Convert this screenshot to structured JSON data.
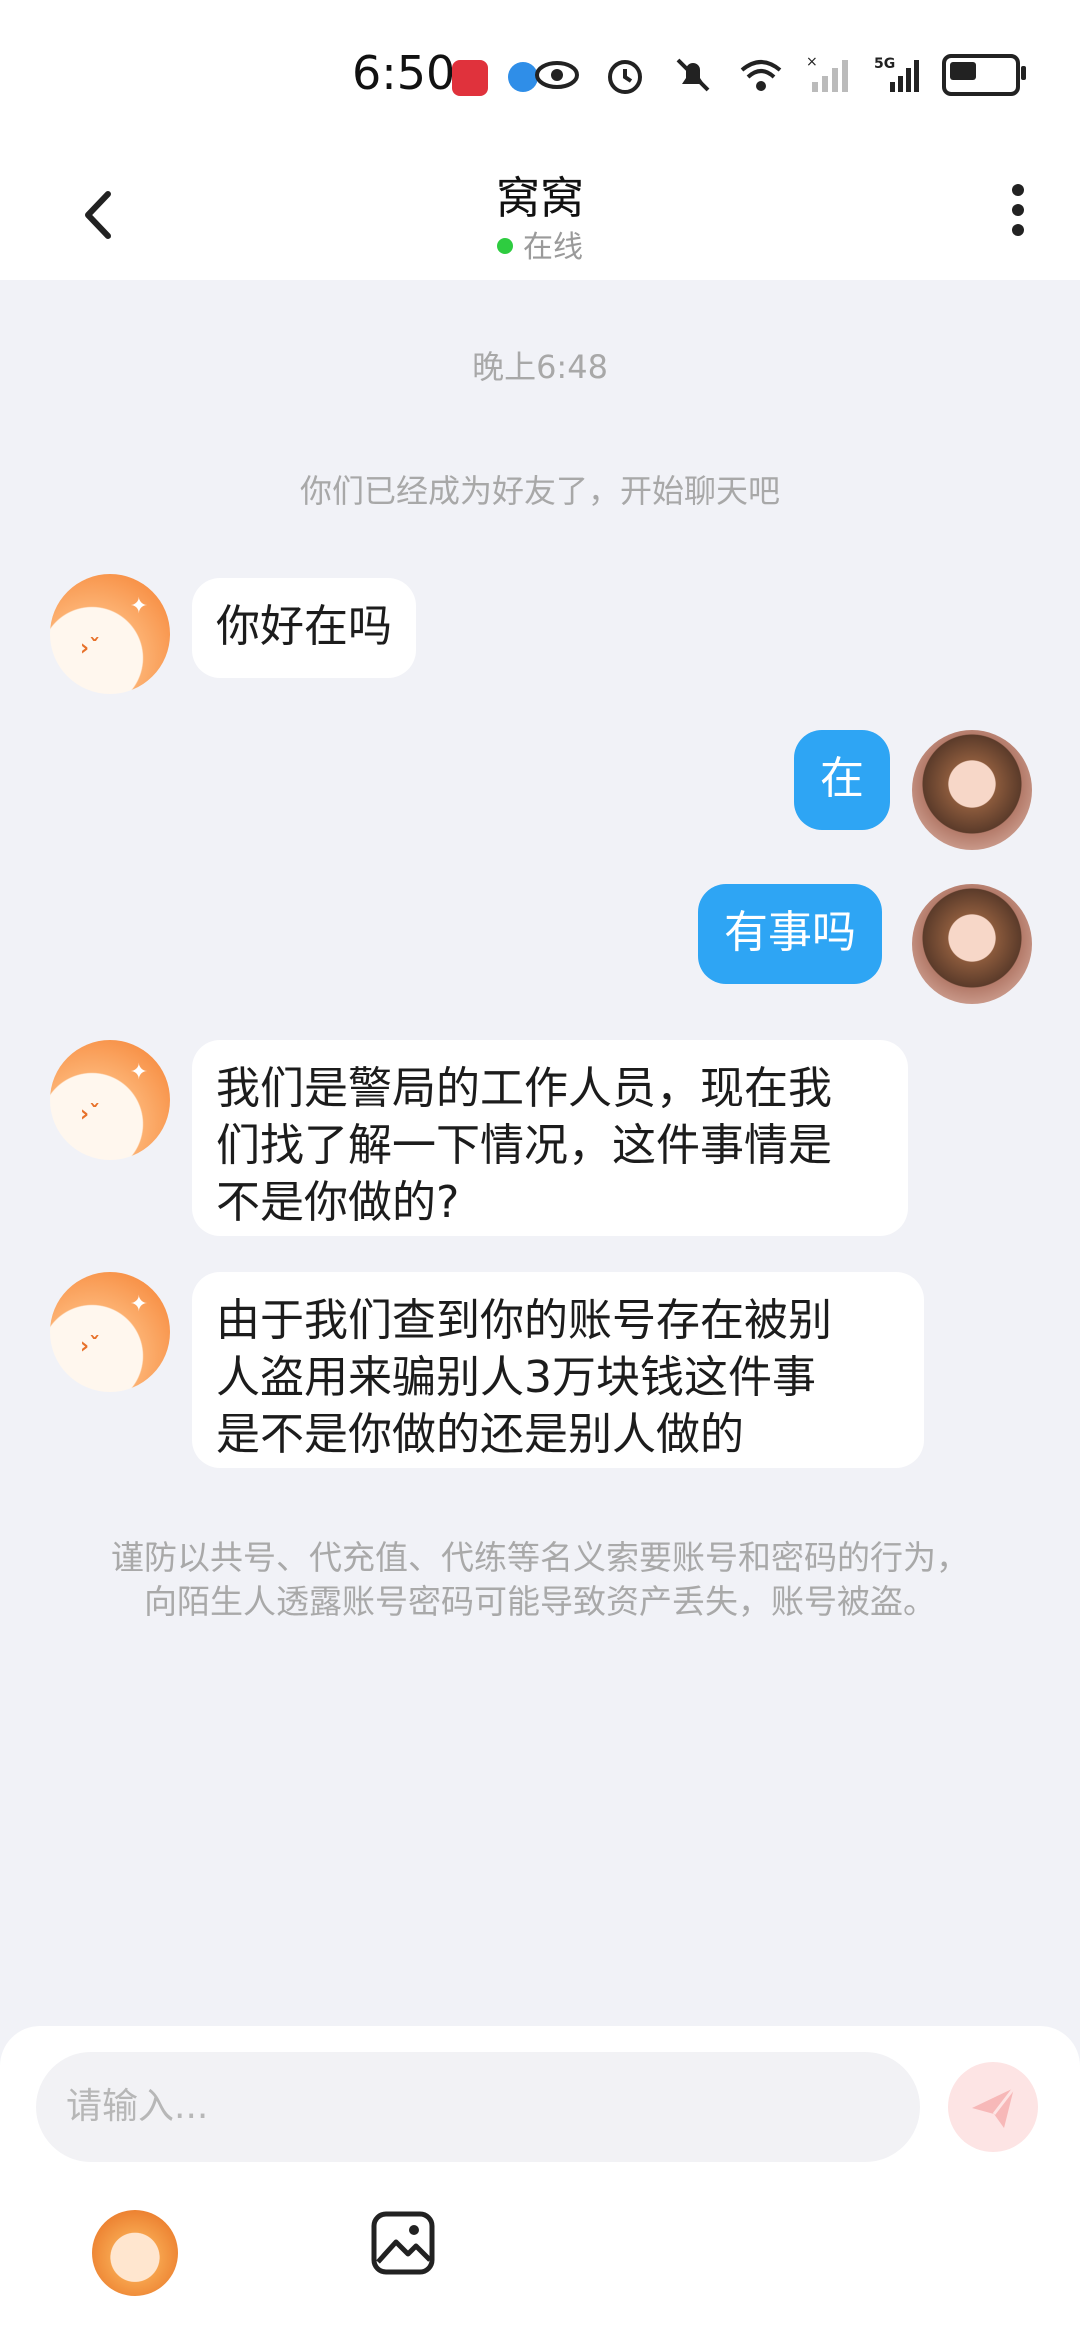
{
  "status_bar": {
    "time": "6:50",
    "network": "5G",
    "icons": [
      "huawei-app-icon",
      "browser-app-icon",
      "eye-icon",
      "alarm-icon",
      "mute-icon",
      "wifi-icon",
      "no-signal-icon",
      "signal-5g-icon",
      "battery-icon"
    ]
  },
  "header": {
    "title": "窝窝",
    "status": "在线",
    "status_color": "#2ecc40"
  },
  "chat": {
    "timestamp": "晚上6:48",
    "system_message": "你们已经成为好友了，开始聊天吧",
    "messages": [
      {
        "sender": "other",
        "text": "你好在吗"
      },
      {
        "sender": "me",
        "text": "在"
      },
      {
        "sender": "me",
        "text": "有事吗"
      },
      {
        "sender": "other",
        "text": "我们是警局的工作人员，现在我\n们找了解一下情况，这件事情是\n不是你做的?"
      },
      {
        "sender": "other",
        "text": "由于我们查到你的账号存在被别\n人盗用来骗别人3万块钱这件事\n是不是你做的还是别人做的"
      }
    ],
    "warning": "谨防以共号、代充值、代练等名义索要账号和密码的行为，向陌生人透露账号密码可能导致资产丢失，账号被盗。"
  },
  "input": {
    "placeholder": "请输入..."
  },
  "colors": {
    "bubble_out": "#2ea5f4",
    "background": "#f1f2f7"
  }
}
